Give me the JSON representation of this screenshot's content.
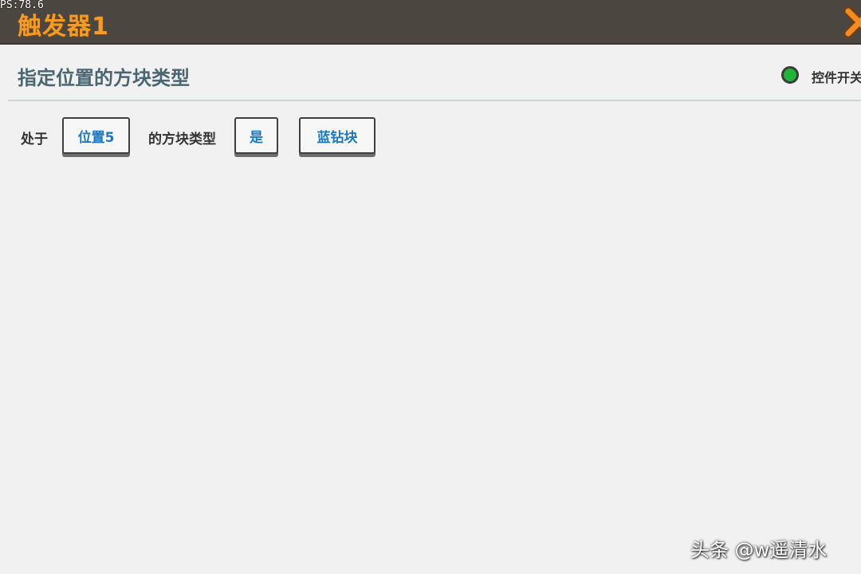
{
  "hud": {
    "fps_text": "PS:78.6"
  },
  "window": {
    "title": "触发器1"
  },
  "condition": {
    "title": "指定位置的方块类型",
    "switch_label": "控件开关",
    "switch_on": true,
    "switch_color": "#23b23a"
  },
  "sentence": {
    "prefix": "处于",
    "position_value": "位置5",
    "middle": "的方块类型",
    "is_value": "是",
    "block_value": "蓝钻块"
  },
  "watermark": {
    "text": "头条 @w遥清水"
  },
  "colors": {
    "title_orange": "#f39a27",
    "param_blue": "#1b79c0",
    "close_x_orange": "#f28c23"
  }
}
